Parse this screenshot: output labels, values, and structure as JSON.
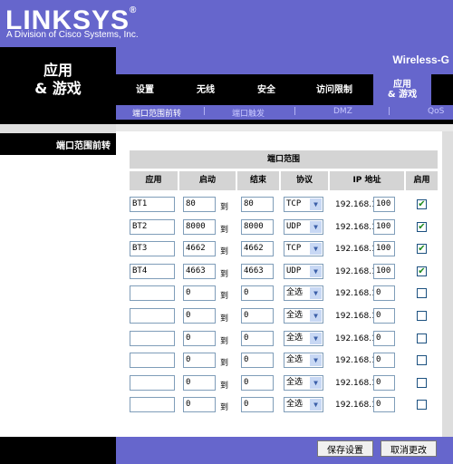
{
  "brand": {
    "logo": "LINKSYS",
    "reg": "®",
    "tagline": "A Division of Cisco Systems, Inc."
  },
  "section": {
    "title_line1": "应用",
    "title_line2": "& 游戏"
  },
  "model": "Wireless-G",
  "nav": [
    "设置",
    "无线",
    "安全",
    "访问限制",
    "应用\n& 游戏"
  ],
  "subnav": [
    "端口范围前转",
    "|",
    "端口触发",
    "|",
    "DMZ",
    "|",
    "QoS"
  ],
  "left_label": "端口范围前转",
  "table": {
    "title": "端口范围",
    "headers": [
      "应用",
      "启动",
      "结束",
      "协议",
      "IP 地址",
      "启用"
    ],
    "to_label": "到",
    "ip_prefix": "192.168.1.",
    "rows": [
      {
        "app": "BT1",
        "start": "80",
        "end": "80",
        "proto": "TCP",
        "ip": "100",
        "enabled": true
      },
      {
        "app": "BT2",
        "start": "8000",
        "end": "8000",
        "proto": "UDP",
        "ip": "100",
        "enabled": true
      },
      {
        "app": "BT3",
        "start": "4662",
        "end": "4662",
        "proto": "TCP",
        "ip": "100",
        "enabled": true
      },
      {
        "app": "BT4",
        "start": "4663",
        "end": "4663",
        "proto": "UDP",
        "ip": "100",
        "enabled": true
      },
      {
        "app": "",
        "start": "0",
        "end": "0",
        "proto": "全选",
        "ip": "0",
        "enabled": false
      },
      {
        "app": "",
        "start": "0",
        "end": "0",
        "proto": "全选",
        "ip": "0",
        "enabled": false
      },
      {
        "app": "",
        "start": "0",
        "end": "0",
        "proto": "全选",
        "ip": "0",
        "enabled": false
      },
      {
        "app": "",
        "start": "0",
        "end": "0",
        "proto": "全选",
        "ip": "0",
        "enabled": false
      },
      {
        "app": "",
        "start": "0",
        "end": "0",
        "proto": "全选",
        "ip": "0",
        "enabled": false
      },
      {
        "app": "",
        "start": "0",
        "end": "0",
        "proto": "全选",
        "ip": "0",
        "enabled": false
      }
    ]
  },
  "buttons": {
    "save": "保存设置",
    "cancel": "取消更改"
  },
  "icons": {
    "check": "check-icon",
    "dropdown": "chevron-down-icon"
  },
  "colors": {
    "purple": "#6666cc",
    "black": "#000000",
    "header_gray": "#d4d4d4"
  }
}
